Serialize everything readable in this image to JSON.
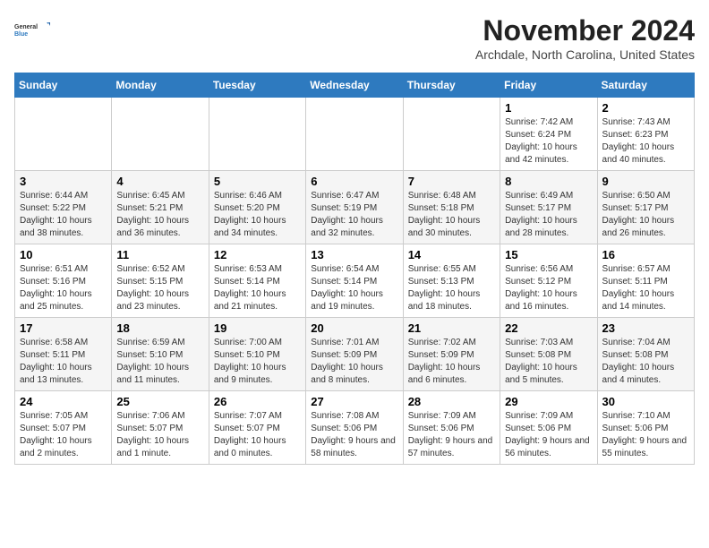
{
  "logo": {
    "line1": "General",
    "line2": "Blue"
  },
  "title": "November 2024",
  "subtitle": "Archdale, North Carolina, United States",
  "weekdays": [
    "Sunday",
    "Monday",
    "Tuesday",
    "Wednesday",
    "Thursday",
    "Friday",
    "Saturday"
  ],
  "weeks": [
    [
      {
        "day": "",
        "info": ""
      },
      {
        "day": "",
        "info": ""
      },
      {
        "day": "",
        "info": ""
      },
      {
        "day": "",
        "info": ""
      },
      {
        "day": "",
        "info": ""
      },
      {
        "day": "1",
        "info": "Sunrise: 7:42 AM\nSunset: 6:24 PM\nDaylight: 10 hours and 42 minutes."
      },
      {
        "day": "2",
        "info": "Sunrise: 7:43 AM\nSunset: 6:23 PM\nDaylight: 10 hours and 40 minutes."
      }
    ],
    [
      {
        "day": "3",
        "info": "Sunrise: 6:44 AM\nSunset: 5:22 PM\nDaylight: 10 hours and 38 minutes."
      },
      {
        "day": "4",
        "info": "Sunrise: 6:45 AM\nSunset: 5:21 PM\nDaylight: 10 hours and 36 minutes."
      },
      {
        "day": "5",
        "info": "Sunrise: 6:46 AM\nSunset: 5:20 PM\nDaylight: 10 hours and 34 minutes."
      },
      {
        "day": "6",
        "info": "Sunrise: 6:47 AM\nSunset: 5:19 PM\nDaylight: 10 hours and 32 minutes."
      },
      {
        "day": "7",
        "info": "Sunrise: 6:48 AM\nSunset: 5:18 PM\nDaylight: 10 hours and 30 minutes."
      },
      {
        "day": "8",
        "info": "Sunrise: 6:49 AM\nSunset: 5:17 PM\nDaylight: 10 hours and 28 minutes."
      },
      {
        "day": "9",
        "info": "Sunrise: 6:50 AM\nSunset: 5:17 PM\nDaylight: 10 hours and 26 minutes."
      }
    ],
    [
      {
        "day": "10",
        "info": "Sunrise: 6:51 AM\nSunset: 5:16 PM\nDaylight: 10 hours and 25 minutes."
      },
      {
        "day": "11",
        "info": "Sunrise: 6:52 AM\nSunset: 5:15 PM\nDaylight: 10 hours and 23 minutes."
      },
      {
        "day": "12",
        "info": "Sunrise: 6:53 AM\nSunset: 5:14 PM\nDaylight: 10 hours and 21 minutes."
      },
      {
        "day": "13",
        "info": "Sunrise: 6:54 AM\nSunset: 5:14 PM\nDaylight: 10 hours and 19 minutes."
      },
      {
        "day": "14",
        "info": "Sunrise: 6:55 AM\nSunset: 5:13 PM\nDaylight: 10 hours and 18 minutes."
      },
      {
        "day": "15",
        "info": "Sunrise: 6:56 AM\nSunset: 5:12 PM\nDaylight: 10 hours and 16 minutes."
      },
      {
        "day": "16",
        "info": "Sunrise: 6:57 AM\nSunset: 5:11 PM\nDaylight: 10 hours and 14 minutes."
      }
    ],
    [
      {
        "day": "17",
        "info": "Sunrise: 6:58 AM\nSunset: 5:11 PM\nDaylight: 10 hours and 13 minutes."
      },
      {
        "day": "18",
        "info": "Sunrise: 6:59 AM\nSunset: 5:10 PM\nDaylight: 10 hours and 11 minutes."
      },
      {
        "day": "19",
        "info": "Sunrise: 7:00 AM\nSunset: 5:10 PM\nDaylight: 10 hours and 9 minutes."
      },
      {
        "day": "20",
        "info": "Sunrise: 7:01 AM\nSunset: 5:09 PM\nDaylight: 10 hours and 8 minutes."
      },
      {
        "day": "21",
        "info": "Sunrise: 7:02 AM\nSunset: 5:09 PM\nDaylight: 10 hours and 6 minutes."
      },
      {
        "day": "22",
        "info": "Sunrise: 7:03 AM\nSunset: 5:08 PM\nDaylight: 10 hours and 5 minutes."
      },
      {
        "day": "23",
        "info": "Sunrise: 7:04 AM\nSunset: 5:08 PM\nDaylight: 10 hours and 4 minutes."
      }
    ],
    [
      {
        "day": "24",
        "info": "Sunrise: 7:05 AM\nSunset: 5:07 PM\nDaylight: 10 hours and 2 minutes."
      },
      {
        "day": "25",
        "info": "Sunrise: 7:06 AM\nSunset: 5:07 PM\nDaylight: 10 hours and 1 minute."
      },
      {
        "day": "26",
        "info": "Sunrise: 7:07 AM\nSunset: 5:07 PM\nDaylight: 10 hours and 0 minutes."
      },
      {
        "day": "27",
        "info": "Sunrise: 7:08 AM\nSunset: 5:06 PM\nDaylight: 9 hours and 58 minutes."
      },
      {
        "day": "28",
        "info": "Sunrise: 7:09 AM\nSunset: 5:06 PM\nDaylight: 9 hours and 57 minutes."
      },
      {
        "day": "29",
        "info": "Sunrise: 7:09 AM\nSunset: 5:06 PM\nDaylight: 9 hours and 56 minutes."
      },
      {
        "day": "30",
        "info": "Sunrise: 7:10 AM\nSunset: 5:06 PM\nDaylight: 9 hours and 55 minutes."
      }
    ]
  ]
}
